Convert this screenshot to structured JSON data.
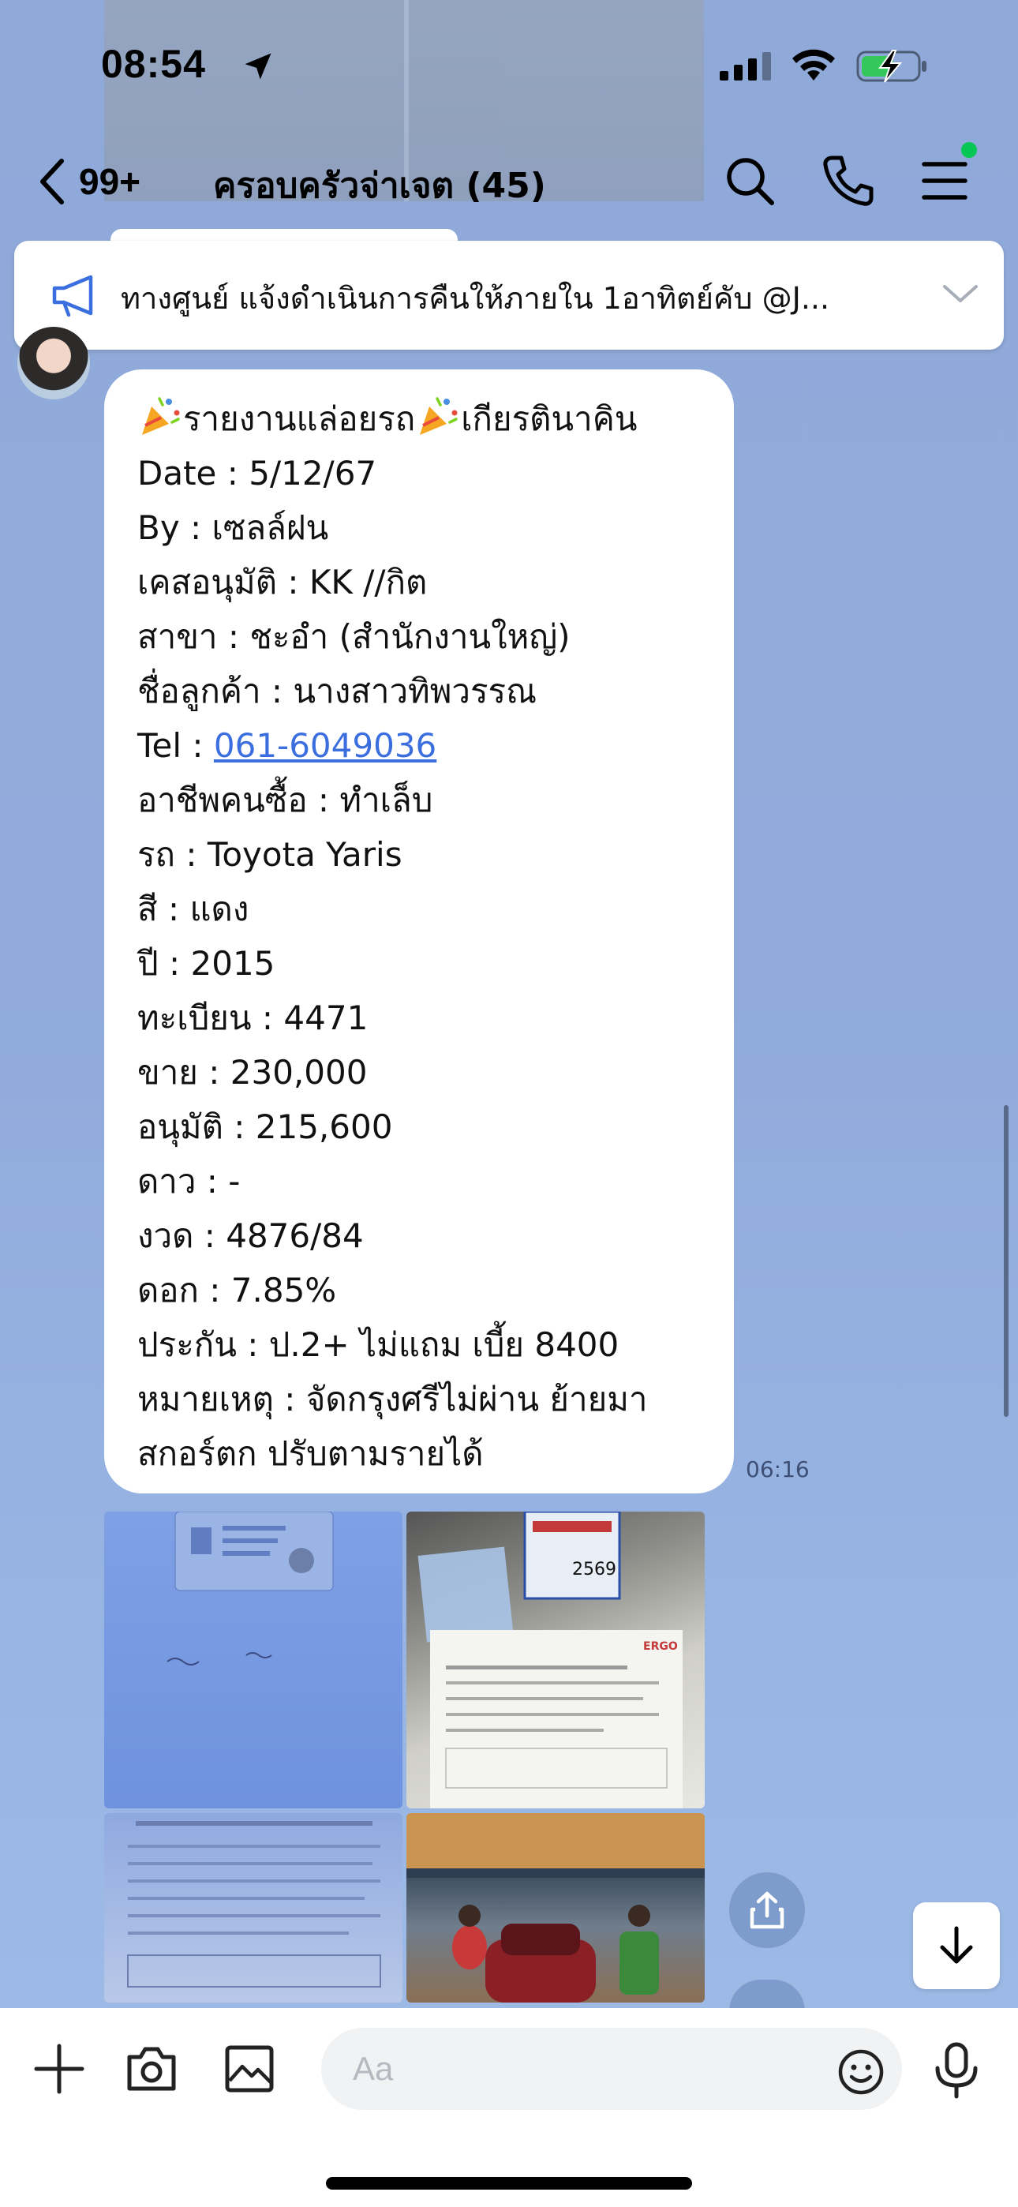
{
  "status_bar": {
    "time": "08:54"
  },
  "header": {
    "back_count": "99+",
    "title": "ครอบครัวจ่าเจต (45)"
  },
  "announcement": {
    "text": "ทางศูนย์ แจ้งดำเนินการคืนให้ภายใน 1อาทิตย์คับ @J..."
  },
  "message": {
    "heading": "รายงานแล่อยรถ",
    "heading_suffix": "เกียรตินาคิน",
    "lines": [
      "Date : 5/12/67",
      "By : เซลล์ฝน",
      "เคสอนุมัติ : KK //กิต",
      "สาขา : ชะอำ (สำนักงานใหญ่)",
      "ชื่อลูกค้า : นางสาวทิพวรรณ"
    ],
    "tel_label": "Tel : ",
    "tel_value": "061-6049036",
    "lines_after": [
      "อาชีพคนซื้อ : ทำเล็บ",
      "รถ : Toyota Yaris",
      "สี : แดง",
      "ปี : 2015",
      "ทะเบียน : 4471",
      "ขาย : 230,000",
      "อนุมัติ : 215,600",
      "ดาว : -",
      "งวด : 4876/84",
      "ดอก : 7.85%",
      "ประกัน : ป.2+ ไม่แถม เบี้ย 8400",
      "หมายเหตุ : จัดกรุงศรีไม่ผ่าน ย้ายมา",
      "สกอร์ตก ปรับตามรายได้"
    ],
    "time": "06:16"
  },
  "photos": {
    "tax_sticker_number": "2569",
    "insurer_mark": "ERGO"
  },
  "input": {
    "placeholder": "Aa"
  },
  "colors": {
    "background": "#8fa9d9",
    "link": "#3b6fe0",
    "online_dot": "#06c755"
  }
}
